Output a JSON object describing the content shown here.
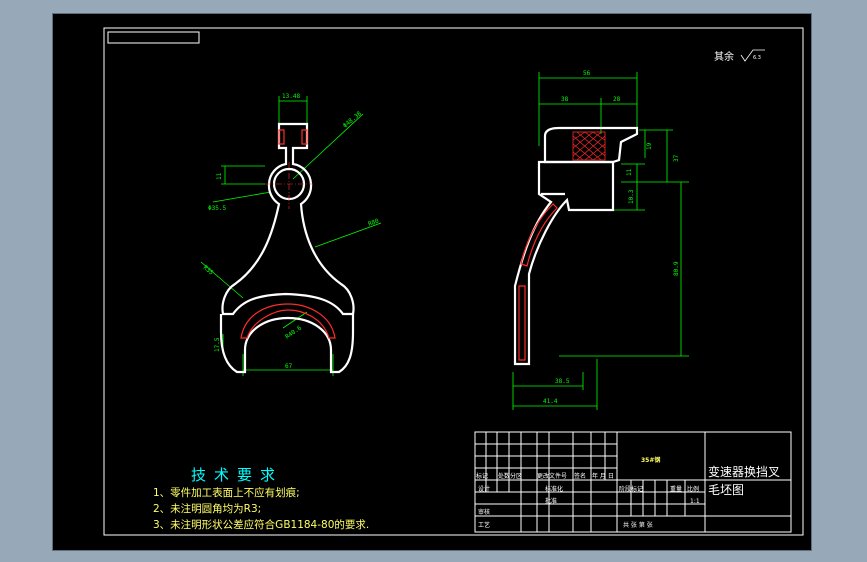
{
  "roughness_note": "其余",
  "roughness_value": "6.3",
  "technical_requirements": {
    "title": "技术要求",
    "lines": [
      "1、零件加工表面上不应有划痕;",
      "2、未注明圆角均为R3;",
      "3、未注明形状公差应符合GB1184-80的要求."
    ]
  },
  "title_block": {
    "material": "35#钢",
    "drawing_name_line1": "变速器换挡叉",
    "drawing_name_line2": "毛坯图",
    "scale_value": "1:1",
    "header_cells": [
      "标记",
      "处数",
      "分区",
      "更改文件号",
      "签名",
      "年 月 日"
    ],
    "left_rows": [
      "设计",
      "",
      "审核",
      "工艺"
    ],
    "mid_rows": [
      "标准化",
      "批准",
      "",
      ""
    ],
    "right_header": [
      "阶段标记",
      "重量",
      "比例"
    ],
    "sheet_footer": [
      "共  张  第  张"
    ]
  },
  "dimensions": {
    "front_view": {
      "top_width": "13.48",
      "boss_dia": "Φ48.38",
      "hole_dia": "Φ35.5",
      "small_height": "11",
      "radius_large": "R80",
      "radius_fork": "R35",
      "fork_inner_radius": "R40.6",
      "fork_height": "17.5",
      "fork_width": "67"
    },
    "side_view": {
      "overall_width": "56",
      "left_width": "38",
      "right_width": "28",
      "head_height": "19",
      "head_total": "37",
      "mid_gap": "11",
      "lower_offset": "10.3",
      "overall_height": "80.9",
      "bottom_width_1": "38.5",
      "bottom_width_2": "41.4"
    }
  }
}
